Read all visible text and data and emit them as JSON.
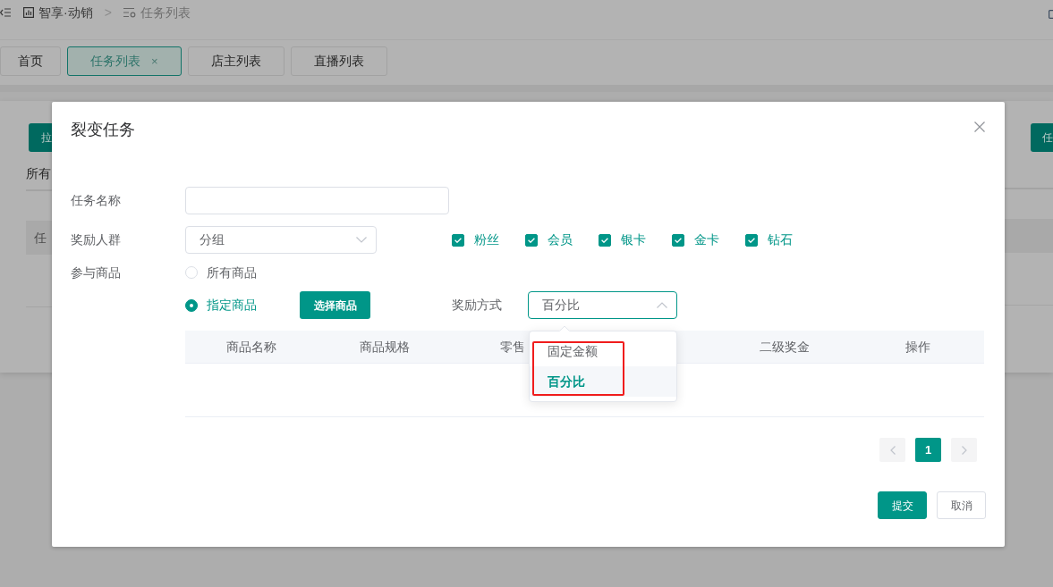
{
  "header": {
    "breadcrumb": [
      {
        "kind": "app",
        "label": "智享·动销"
      },
      {
        "kind": "page",
        "label": "任务列表"
      }
    ],
    "separator": ">"
  },
  "tabs": [
    {
      "label": "首页",
      "selected": false
    },
    {
      "label": "任务列表",
      "selected": true,
      "close": "×"
    },
    {
      "label": "店主列表",
      "selected": false
    },
    {
      "label": "直播列表",
      "selected": false
    }
  ],
  "background_page": {
    "left_button": "拉",
    "filter_tab": "所有",
    "table_header": "任",
    "right_button": "任"
  },
  "dialog": {
    "title": "裂变任务",
    "task_name": {
      "label": "任务名称"
    },
    "audience": {
      "label": "奖励人群",
      "select": {
        "value": "分组",
        "expanded": false
      },
      "levels": [
        {
          "label": "粉丝",
          "checked": true
        },
        {
          "label": "会员",
          "checked": true
        },
        {
          "label": "银卡",
          "checked": true
        },
        {
          "label": "金卡",
          "checked": true
        },
        {
          "label": "钻石",
          "checked": true
        }
      ]
    },
    "products": {
      "label": "参与商品",
      "options": [
        {
          "label": "所有商品",
          "selected": false
        },
        {
          "label": "指定商品",
          "selected": true
        }
      ],
      "choose_button": "选择商品"
    },
    "reward_mode": {
      "label": "奖励方式",
      "select": {
        "value": "百分比",
        "expanded": true
      },
      "options": [
        {
          "label": "固定金额",
          "selected": false
        },
        {
          "label": "百分比",
          "selected": true
        }
      ]
    },
    "table": {
      "columns": [
        {
          "label": "商品名称"
        },
        {
          "label": "商品规格"
        },
        {
          "label": "零售",
          "partial": true
        },
        {
          "label": "二级奖金"
        },
        {
          "label": "操作"
        }
      ]
    },
    "pagination": {
      "pages": [
        {
          "label": "1",
          "selected": true
        }
      ]
    },
    "actions": [
      {
        "label": "提交",
        "kind": "primary"
      },
      {
        "label": "取消",
        "kind": "default"
      }
    ]
  }
}
